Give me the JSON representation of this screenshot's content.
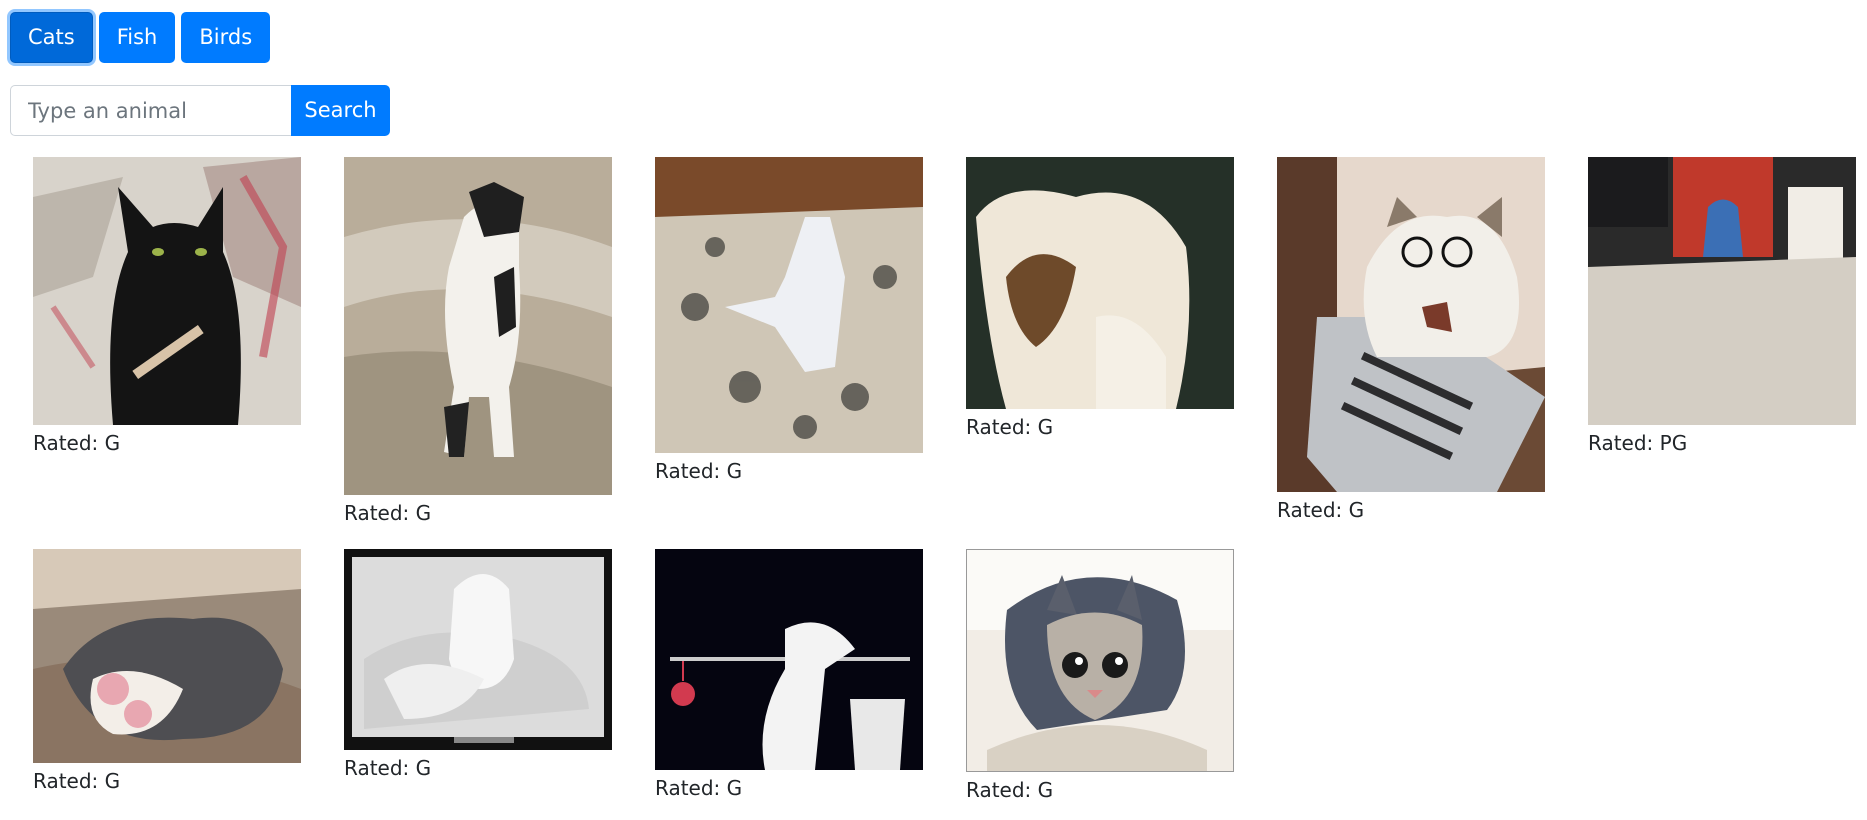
{
  "nav": {
    "buttons": [
      {
        "label": "Cats",
        "active": true
      },
      {
        "label": "Fish",
        "active": false
      },
      {
        "label": "Birds",
        "active": false
      }
    ]
  },
  "search": {
    "placeholder": "Type an animal",
    "value": "",
    "button_label": "Search"
  },
  "results": [
    {
      "subject": "black cat filing its nails",
      "rating_text": "Rated: G"
    },
    {
      "subject": "cat standing on hind legs",
      "rating_text": "Rated: G"
    },
    {
      "subject": "cat dancing on rug",
      "rating_text": "Rated: G"
    },
    {
      "subject": "fluffy cat close-up",
      "rating_text": "Rated: G"
    },
    {
      "subject": "cat with glasses at laptop",
      "rating_text": "Rated: G"
    },
    {
      "subject": "carpeted room with vase painting",
      "rating_text": "Rated: PG"
    },
    {
      "subject": "kitten sleeping on its back",
      "rating_text": "Rated: G"
    },
    {
      "subject": "white cat sitting upright",
      "rating_text": "Rated: G"
    },
    {
      "subject": "cat hanging on a bar",
      "rating_text": "Rated: G"
    },
    {
      "subject": "tabby cat crouching",
      "rating_text": "Rated: G"
    }
  ],
  "colors": {
    "primary": "#007bff",
    "primary_active": "#0069d9",
    "text": "#212529"
  }
}
